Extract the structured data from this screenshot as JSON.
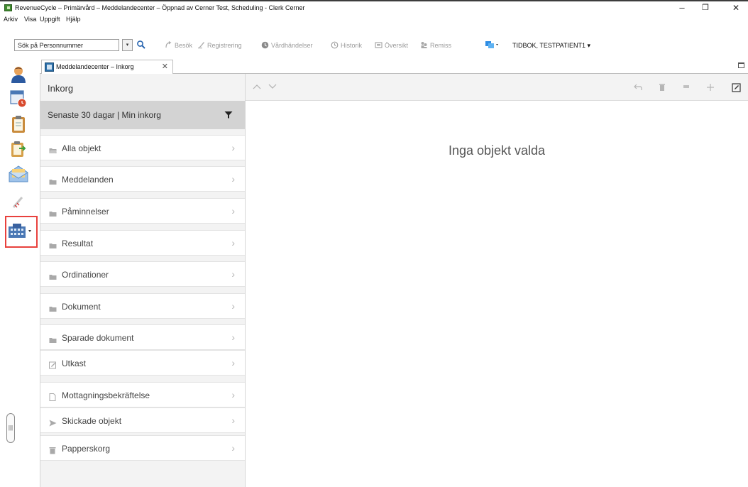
{
  "window": {
    "title": "RevenueCycle – Primärvård – Meddelandecenter – Öppnad av Cerner Test, Scheduling - Clerk Cerner",
    "minimize": "–",
    "maximize": "❐",
    "close": "✕"
  },
  "menu": [
    "Arkiv",
    "Visa",
    "Uppgift",
    "Hjälp"
  ],
  "toolbar": {
    "search_value": "Sök på Personnummer",
    "dropdown_glyph": "▾",
    "items": [
      "Besök",
      "Registrering",
      "Vårdhändelser",
      "Historik",
      "Översikt",
      "Remiss"
    ],
    "patient": "TIDBOK, TESTPATIENT1  ▾"
  },
  "tab": {
    "label": "Meddelandecenter – Inkorg",
    "close": "✕"
  },
  "inbox": {
    "header": "Inkorg",
    "filter": "Senaste 30 dagar | Min inkorg",
    "folders": [
      {
        "label": "Alla objekt",
        "icon": "folder-open-icon"
      },
      {
        "label": "Meddelanden",
        "icon": "folder-icon"
      },
      {
        "label": "Påminnelser",
        "icon": "folder-icon"
      },
      {
        "label": "Resultat",
        "icon": "folder-icon"
      },
      {
        "label": "Ordinationer",
        "icon": "folder-icon"
      },
      {
        "label": "Dokument",
        "icon": "folder-icon"
      },
      {
        "label": "Sparade dokument",
        "icon": "folder-icon"
      },
      {
        "label": "Utkast",
        "icon": "pencil-square-icon"
      },
      {
        "label": "Mottagningsbekräftelse",
        "icon": "document-icon"
      },
      {
        "label": "Skickade objekt",
        "icon": "send-icon"
      },
      {
        "label": "Papperskorg",
        "icon": "trash-icon"
      }
    ],
    "chevron": "›"
  },
  "detail": {
    "empty_message": "Inga objekt valda"
  },
  "colors": {
    "highlight": "#e8413d",
    "filter_bar": "#d3d3d3",
    "panel": "#f3f3f3"
  }
}
